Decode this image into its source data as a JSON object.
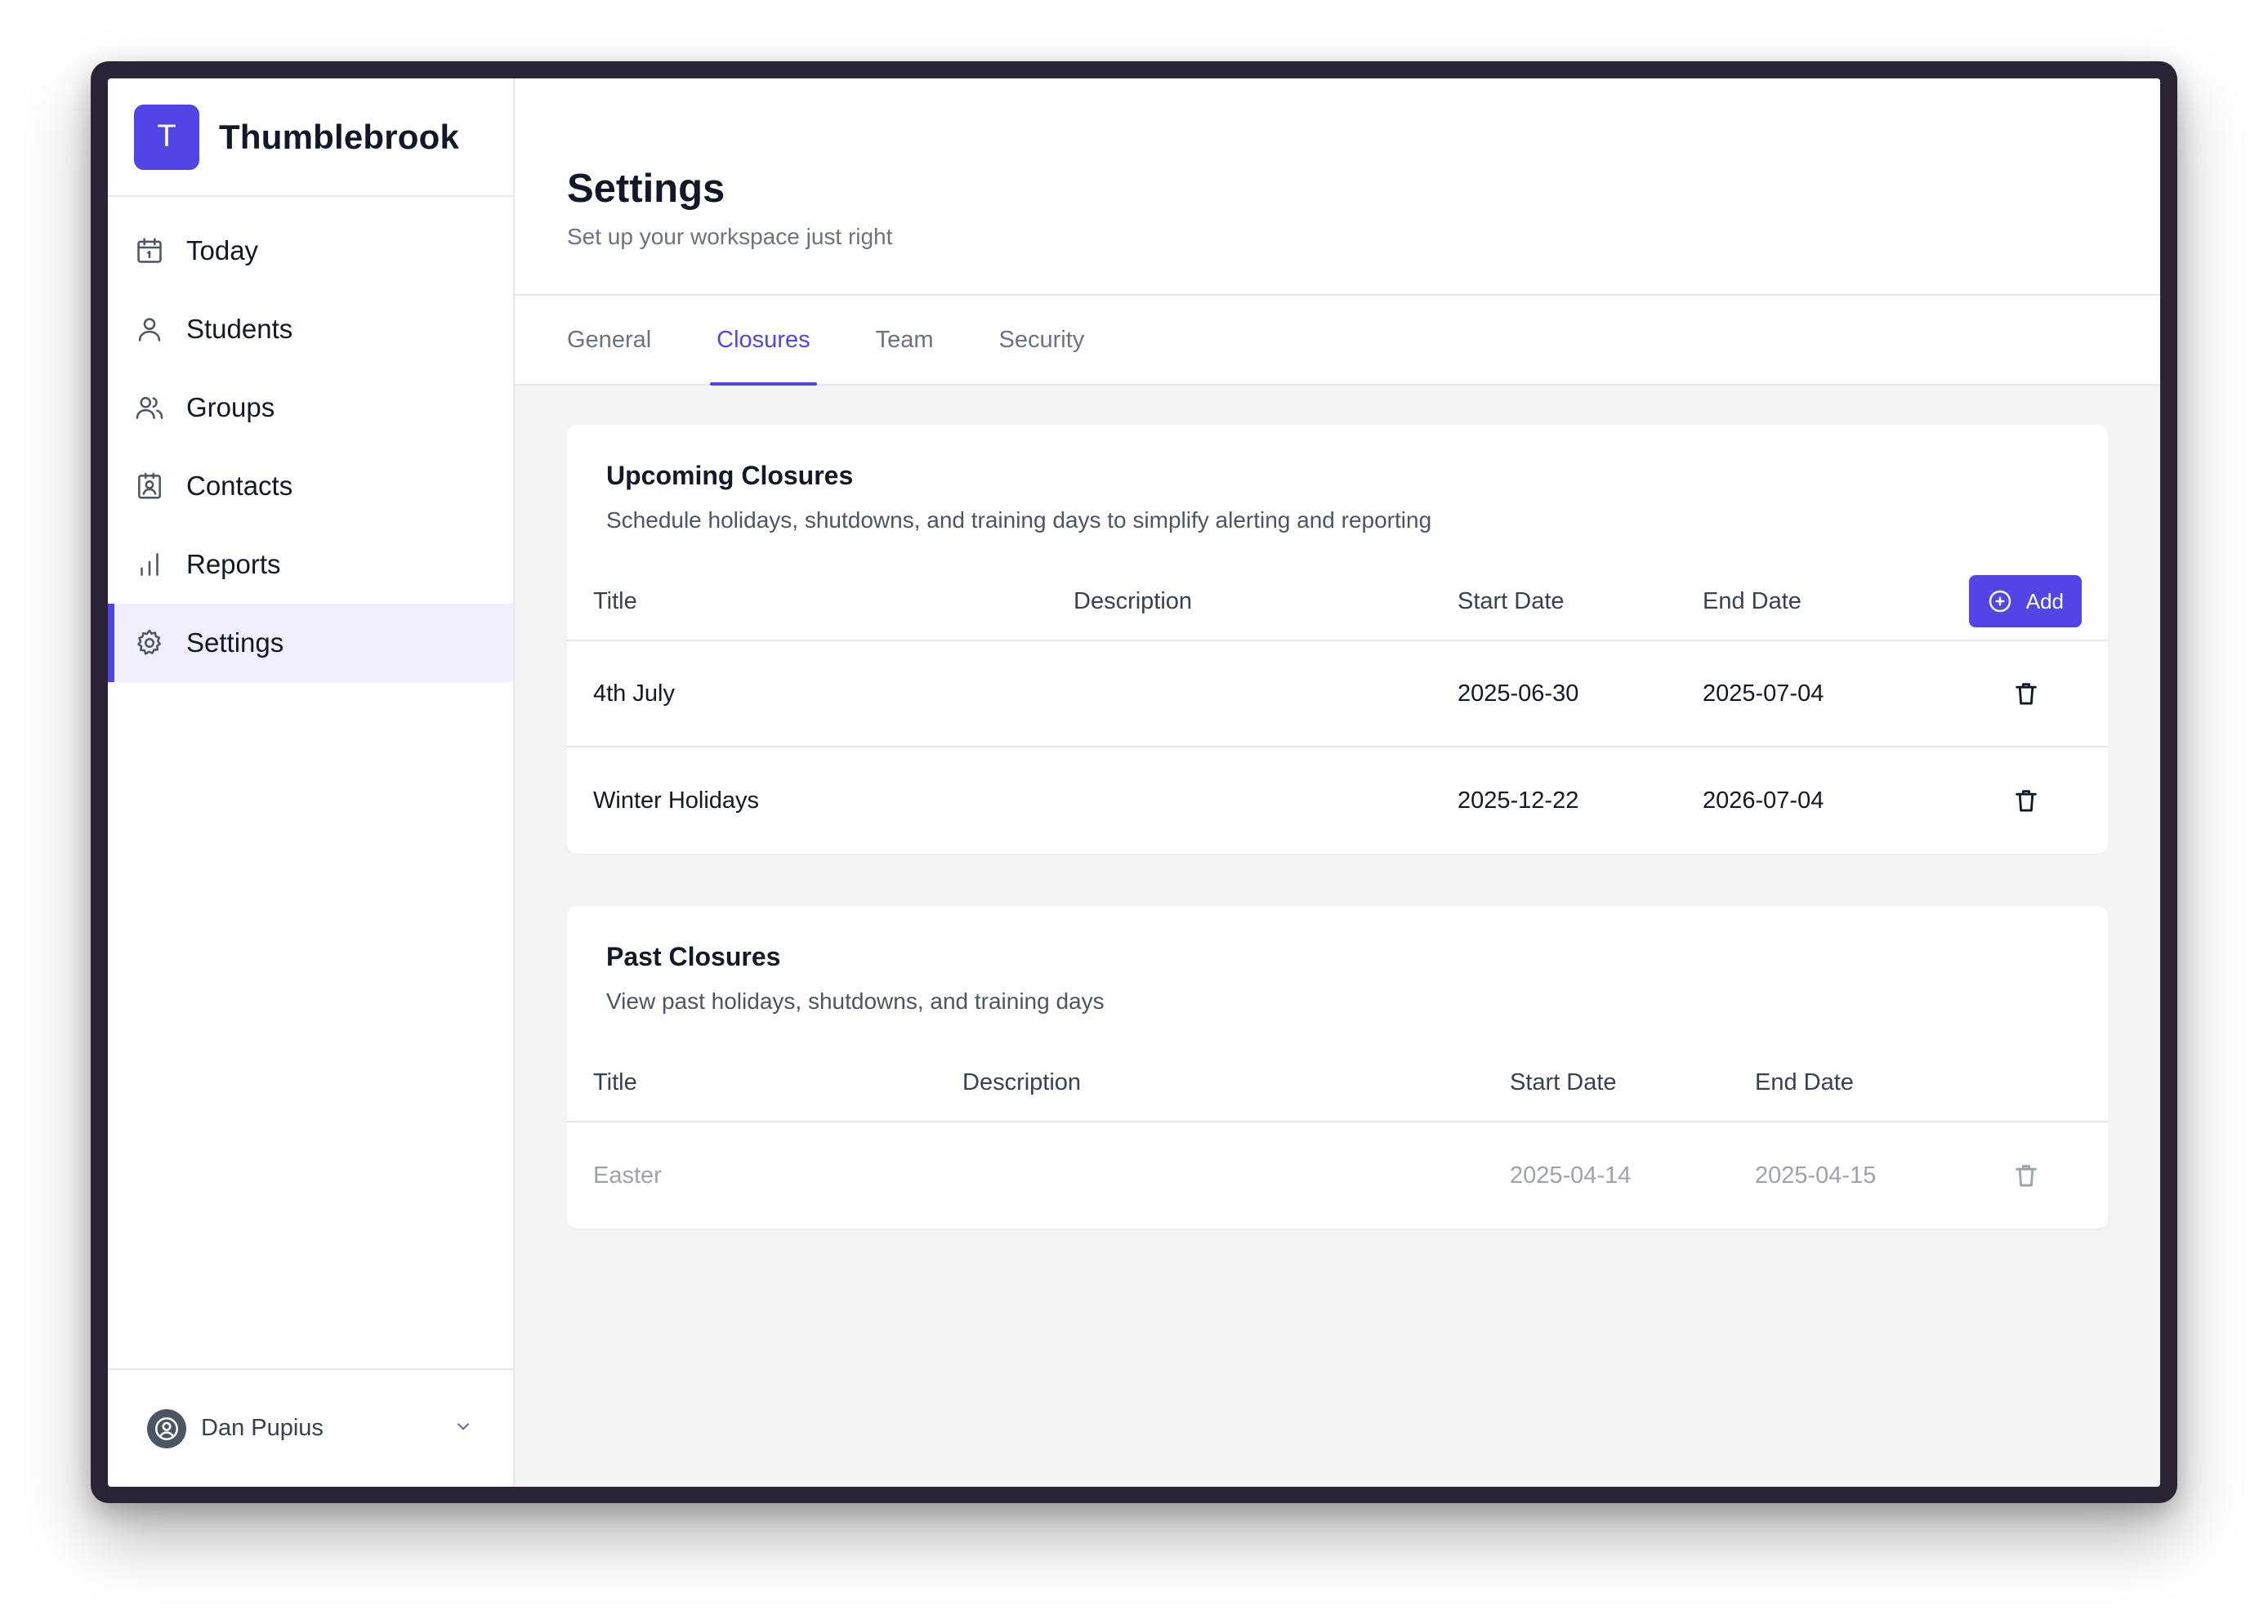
{
  "brand": {
    "initial": "T",
    "name": "Thumblebrook"
  },
  "sidebar": {
    "items": [
      {
        "label": "Today",
        "icon": "calendar-icon"
      },
      {
        "label": "Students",
        "icon": "user-icon"
      },
      {
        "label": "Groups",
        "icon": "users-icon"
      },
      {
        "label": "Contacts",
        "icon": "contact-card-icon"
      },
      {
        "label": "Reports",
        "icon": "bar-chart-icon"
      },
      {
        "label": "Settings",
        "icon": "gear-icon",
        "active": true
      }
    ],
    "user": {
      "name": "Dan Pupius"
    }
  },
  "header": {
    "title": "Settings",
    "subtitle": "Set up your workspace just right"
  },
  "tabs": [
    {
      "label": "General"
    },
    {
      "label": "Closures",
      "active": true
    },
    {
      "label": "Team"
    },
    {
      "label": "Security"
    }
  ],
  "upcoming": {
    "title": "Upcoming Closures",
    "description": "Schedule holidays, shutdowns, and training days to simplify alerting and reporting",
    "columns": [
      "Title",
      "Description",
      "Start Date",
      "End Date"
    ],
    "add_label": "Add",
    "rows": [
      {
        "title": "4th July",
        "description": "",
        "start": "2025-06-30",
        "end": "2025-07-04"
      },
      {
        "title": "Winter Holidays",
        "description": "",
        "start": "2025-12-22",
        "end": "2026-07-04"
      }
    ]
  },
  "past": {
    "title": "Past Closures",
    "description": "View past holidays, shutdowns, and training days",
    "columns": [
      "Title",
      "Description",
      "Start Date",
      "End Date"
    ],
    "rows": [
      {
        "title": "Easter",
        "description": "",
        "start": "2025-04-14",
        "end": "2025-04-15"
      }
    ]
  },
  "colors": {
    "accent": "#4f46e5",
    "active_nav_bg": "#f1effd",
    "content_bg": "#f3f4f6",
    "past_text": "#9ca3af"
  }
}
